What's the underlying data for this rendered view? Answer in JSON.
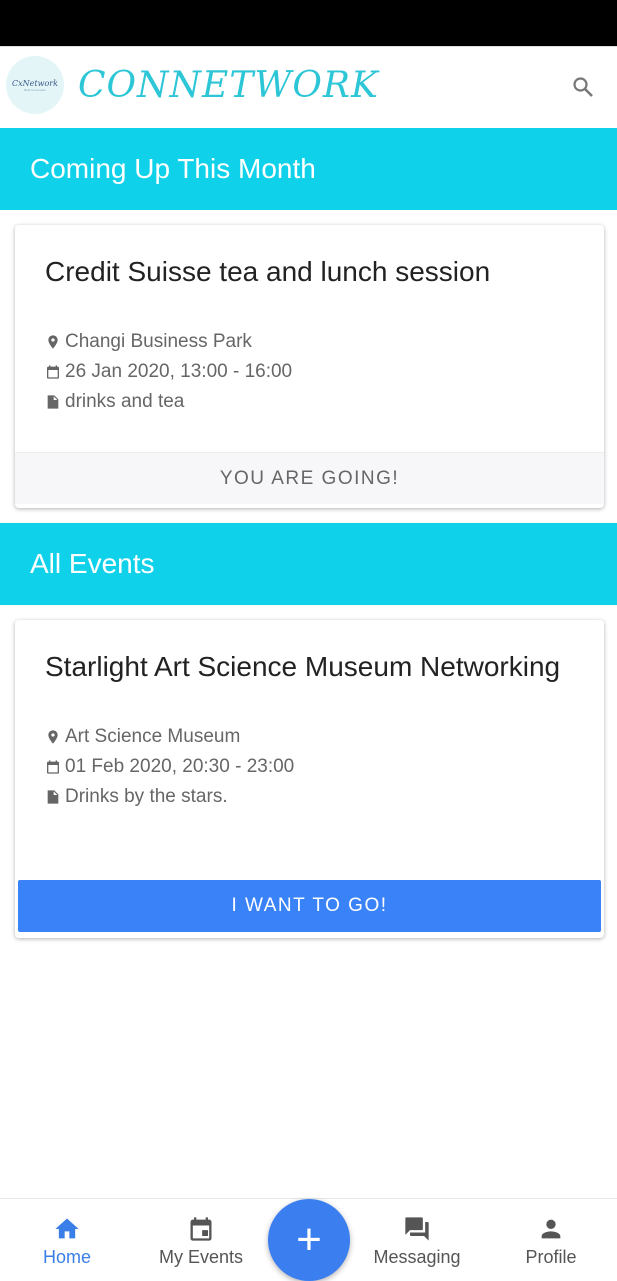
{
  "app": {
    "brand": "CONNETWORK",
    "logo_text": "CxNetwork",
    "logo_tagline": "Built to Connect"
  },
  "sections": {
    "upcoming": "Coming Up This Month",
    "all": "All Events"
  },
  "events": [
    {
      "title": "Credit Suisse tea and lunch session",
      "location": "Changi Business Park",
      "datetime": "26 Jan 2020, 13:00 - 16:00",
      "description": "drinks and tea",
      "action": "YOU ARE GOING!"
    },
    {
      "title": "Starlight Art Science Museum Networking",
      "location": "Art Science Museum",
      "datetime": "01 Feb 2020, 20:30 - 23:00",
      "description": "Drinks by the stars.",
      "action": "I WANT TO GO!"
    }
  ],
  "nav": {
    "home": "Home",
    "my_events": "My Events",
    "fab": "+",
    "messaging": "Messaging",
    "profile": "Profile"
  },
  "colors": {
    "accent": "#0fd2ea",
    "primary": "#3a82f7"
  }
}
